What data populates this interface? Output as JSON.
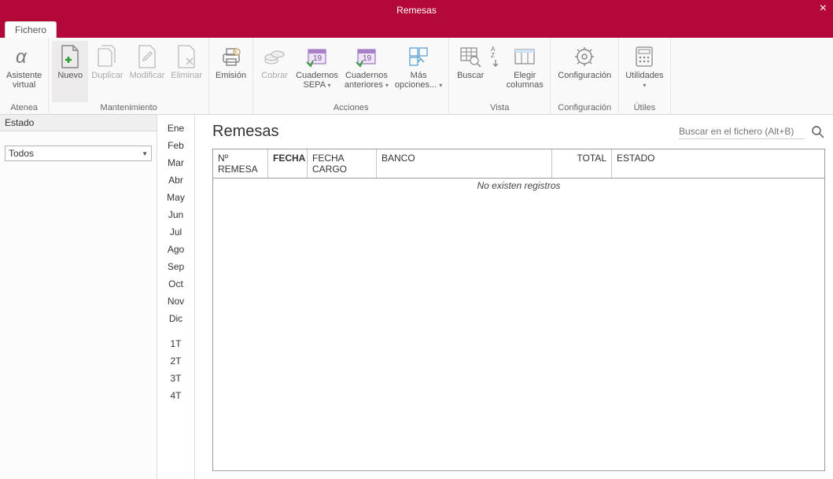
{
  "window": {
    "title": "Remesas",
    "close": "×"
  },
  "tabs": {
    "fichero": "Fichero"
  },
  "ribbon": {
    "asistente": {
      "l1": "Asistente",
      "l2": "virtual",
      "group": "Atenea"
    },
    "nuevo": "Nuevo",
    "duplicar": "Duplicar",
    "modificar": "Modificar",
    "eliminar": "Eliminar",
    "mantenimiento_group": "Mantenimiento",
    "emision": "Emisión",
    "cobrar": "Cobrar",
    "cuadernos_sepa": {
      "l1": "Cuadernos",
      "l2": "SEPA"
    },
    "cuadernos_ant": {
      "l1": "Cuadernos",
      "l2": "anteriores"
    },
    "mas_opciones": {
      "l1": "Más",
      "l2": "opciones..."
    },
    "acciones_group": "Acciones",
    "buscar": "Buscar",
    "elegir_col": {
      "l1": "Elegir",
      "l2": "columnas"
    },
    "vista_group": "Vista",
    "configuracion": "Configuración",
    "config_group": "Configuración",
    "utilidades": "Utilidades",
    "utiles_group": "Útiles"
  },
  "sidebar": {
    "state_label": "Estado",
    "combo_value": "Todos"
  },
  "months": {
    "ene": "Ene",
    "feb": "Feb",
    "mar": "Mar",
    "abr": "Abr",
    "may": "May",
    "jun": "Jun",
    "jul": "Jul",
    "ago": "Ago",
    "sep": "Sep",
    "oct": "Oct",
    "nov": "Nov",
    "dic": "Dic",
    "t1": "1T",
    "t2": "2T",
    "t3": "3T",
    "t4": "4T"
  },
  "main": {
    "title": "Remesas",
    "search_placeholder": "Buscar en el fichero (Alt+B)"
  },
  "grid": {
    "headers": {
      "num_remesa": "Nº REMESA",
      "fecha": "FECHA",
      "fecha_cargo": "FECHA CARGO",
      "banco": "BANCO",
      "total": "TOTAL",
      "estado": "ESTADO"
    },
    "empty": "No existen registros"
  }
}
